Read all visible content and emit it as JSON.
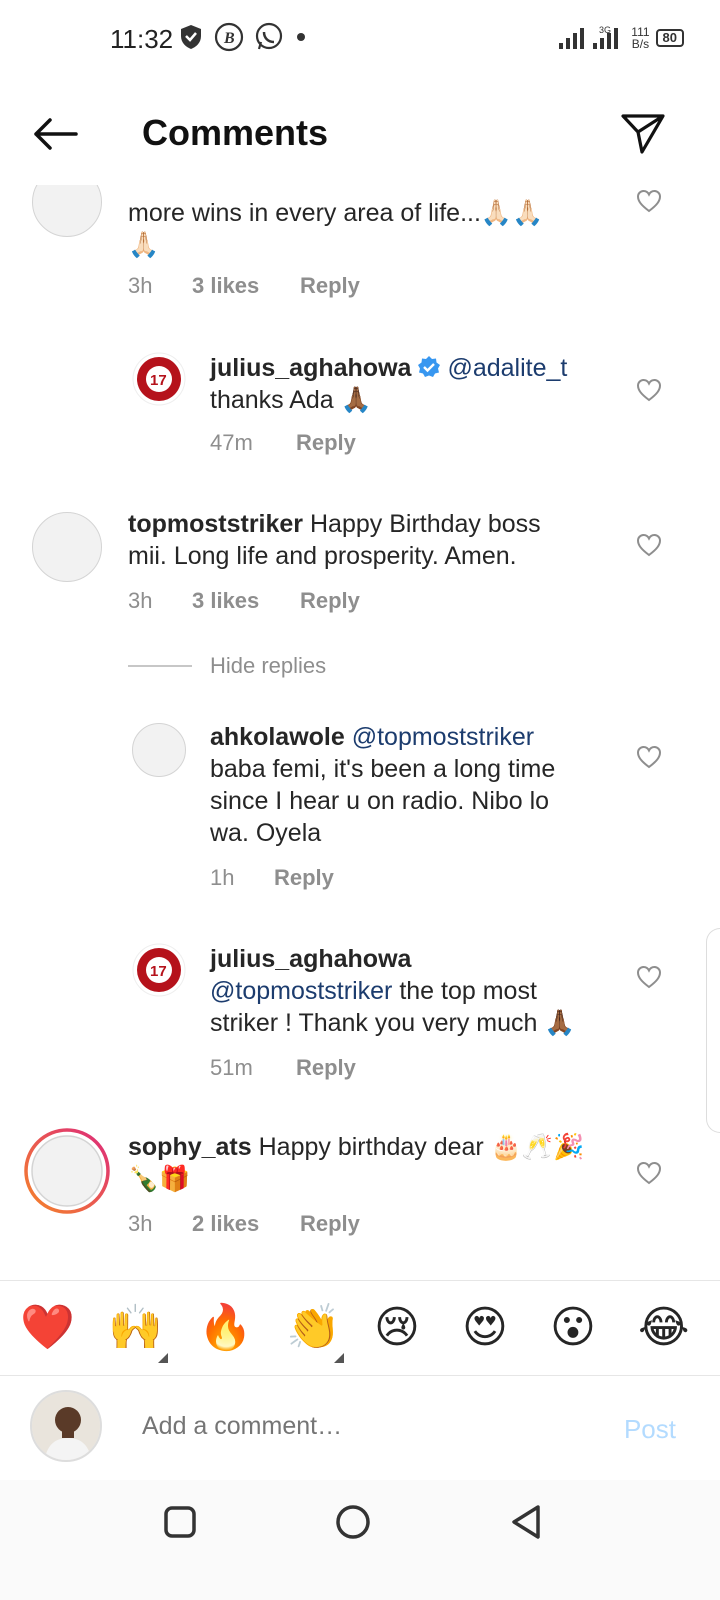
{
  "status_bar": {
    "time": "11:32",
    "net_speed_value": "111",
    "net_speed_unit": "B/s",
    "network_type": "3G",
    "battery": "80"
  },
  "header": {
    "title": "Comments"
  },
  "comments": [
    {
      "id": "c1",
      "username": "",
      "text": "more wins in every area of life...🙏🏻🙏🏻",
      "text_line2": "🙏🏻",
      "time": "3h",
      "likes": "3 likes",
      "reply_label": "Reply"
    },
    {
      "id": "r1",
      "username": "julius_aghahowa",
      "mention": "@adalite_t",
      "text": "thanks Ada 🙏🏾",
      "time": "47m",
      "reply_label": "Reply"
    },
    {
      "id": "c2",
      "username": "topmoststriker",
      "text": "Happy Birthday boss",
      "text_line2": "mii. Long life and prosperity. Amen.",
      "time": "3h",
      "likes": "3 likes",
      "reply_label": "Reply"
    },
    {
      "id": "r2",
      "username": "ahkolawole",
      "mention": "@topmoststriker",
      "line2": "baba femi, it's been a long time",
      "line3": "since I hear u on radio. Nibo lo",
      "line4": "wa. Oyela",
      "time": "1h",
      "reply_label": "Reply"
    },
    {
      "id": "r3",
      "username": "julius_aghahowa",
      "mention": "@topmoststriker",
      "text": "the top most",
      "line3": "striker ! Thank you very much 🙏🏾",
      "time": "51m",
      "reply_label": "Reply"
    },
    {
      "id": "c3",
      "username": "sophy_ats",
      "text": "Happy birthday dear 🎂🥂🎉",
      "text_line2": "🍾🎁",
      "time": "3h",
      "likes": "2 likes",
      "reply_label": "Reply"
    }
  ],
  "hide_replies_label": "Hide replies",
  "emoji_bar": [
    "❤️",
    "🙌",
    "🔥",
    "👏",
    "😢",
    "😍",
    "😮",
    "😂"
  ],
  "composer": {
    "placeholder": "Add a comment…",
    "post_label": "Post"
  },
  "logo_text": "17",
  "colors": {
    "mention": "#1c3c6e",
    "meta": "#8e8e8e",
    "post_disabled": "#b3dbff",
    "verified": "#3897f0",
    "story_ring_start": "#f58529",
    "story_ring_end": "#dd2a7b"
  }
}
